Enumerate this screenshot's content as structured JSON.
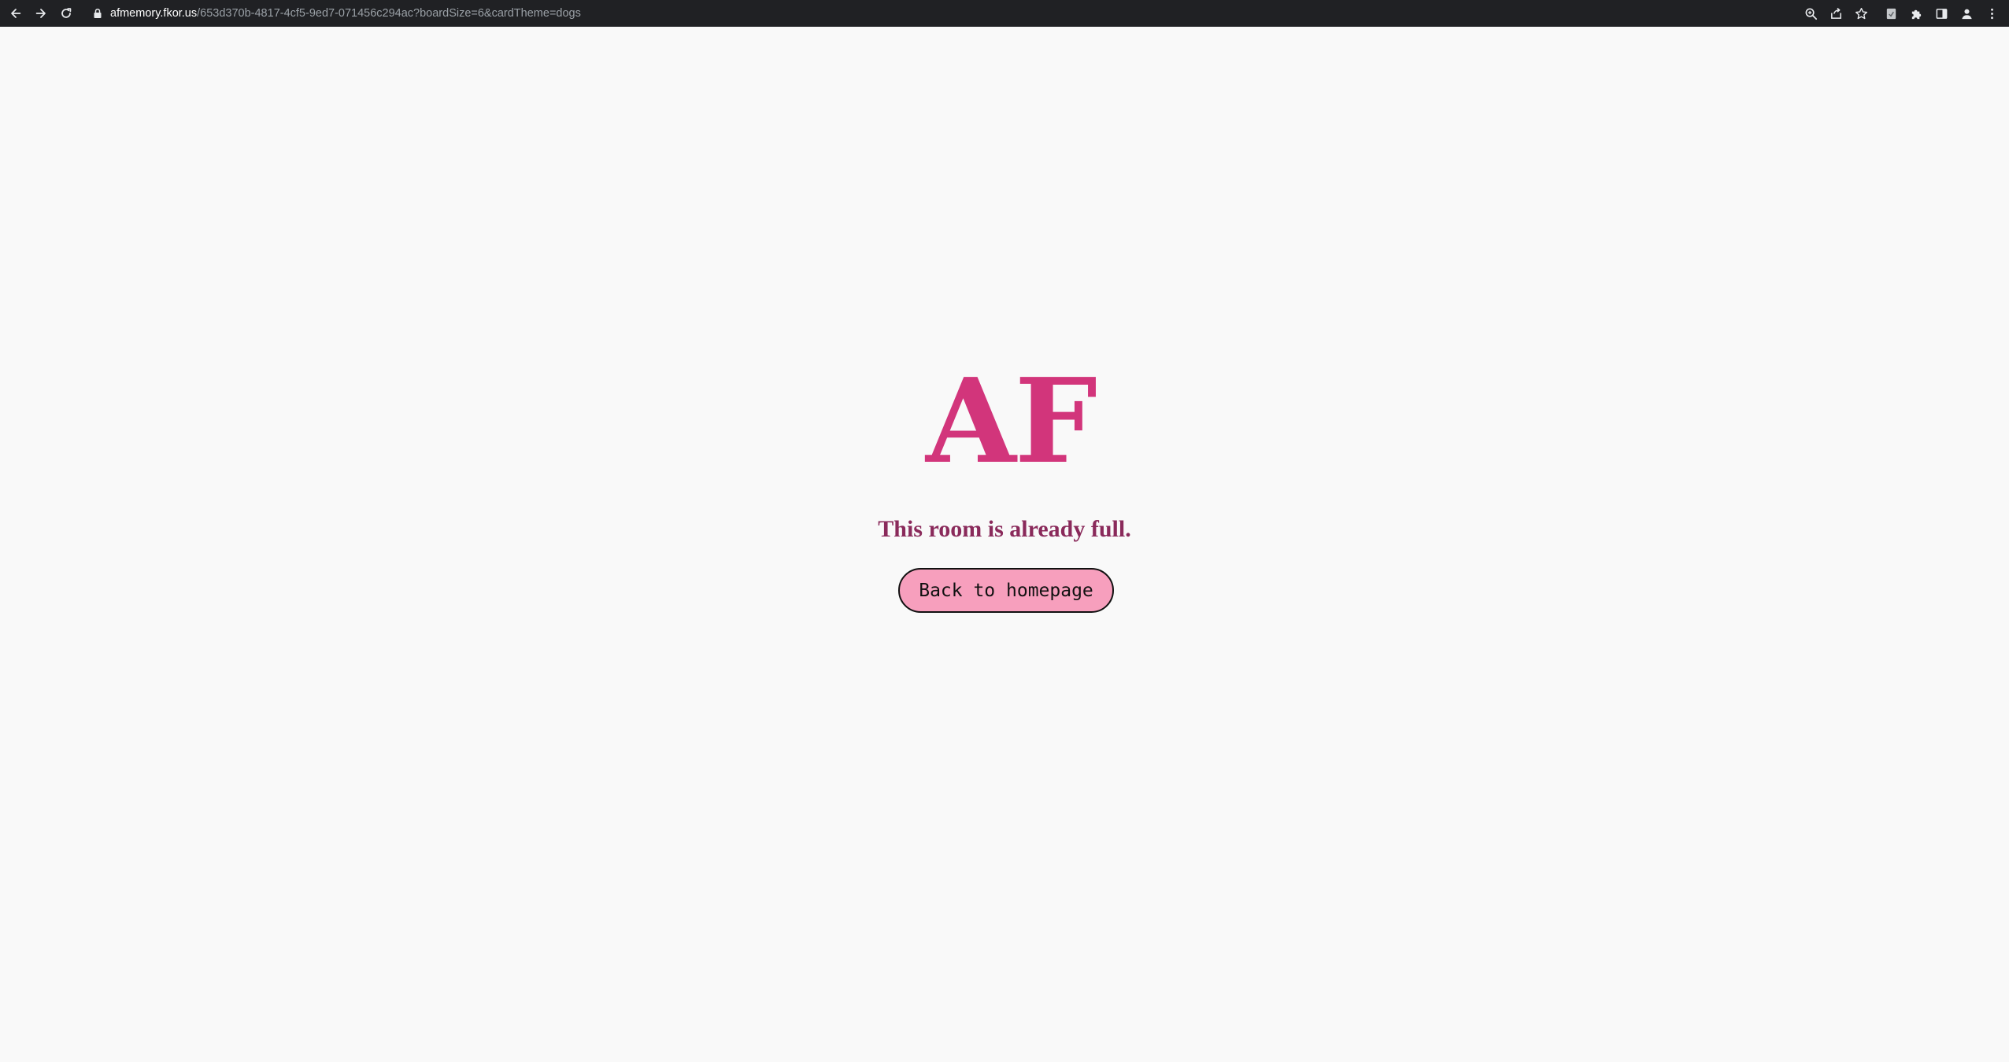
{
  "browser": {
    "url_host": "afmemory.fkor.us",
    "url_rest": "/653d370b-4817-4cf5-9ed7-071456c294ac?boardSize=6&cardTheme=dogs",
    "nav_icons": [
      "back-arrow-icon",
      "forward-arrow-icon",
      "reload-icon"
    ],
    "toolbar_icons": [
      "zoom-icon",
      "share-icon",
      "bookmark-star-icon",
      "extension-icon",
      "puzzle-extensions-icon",
      "side-panel-icon",
      "profile-icon",
      "menu-kebab-icon"
    ]
  },
  "page": {
    "logo_text": "AF",
    "message": "This room is already full.",
    "home_button_label": "Back to homepage"
  },
  "colors": {
    "background": "#f9f9f9",
    "logo": "#d2357b",
    "message": "#8a2a5b",
    "button_fill": "#f79fbd",
    "button_border": "#111111",
    "toolbar": "#202124"
  }
}
